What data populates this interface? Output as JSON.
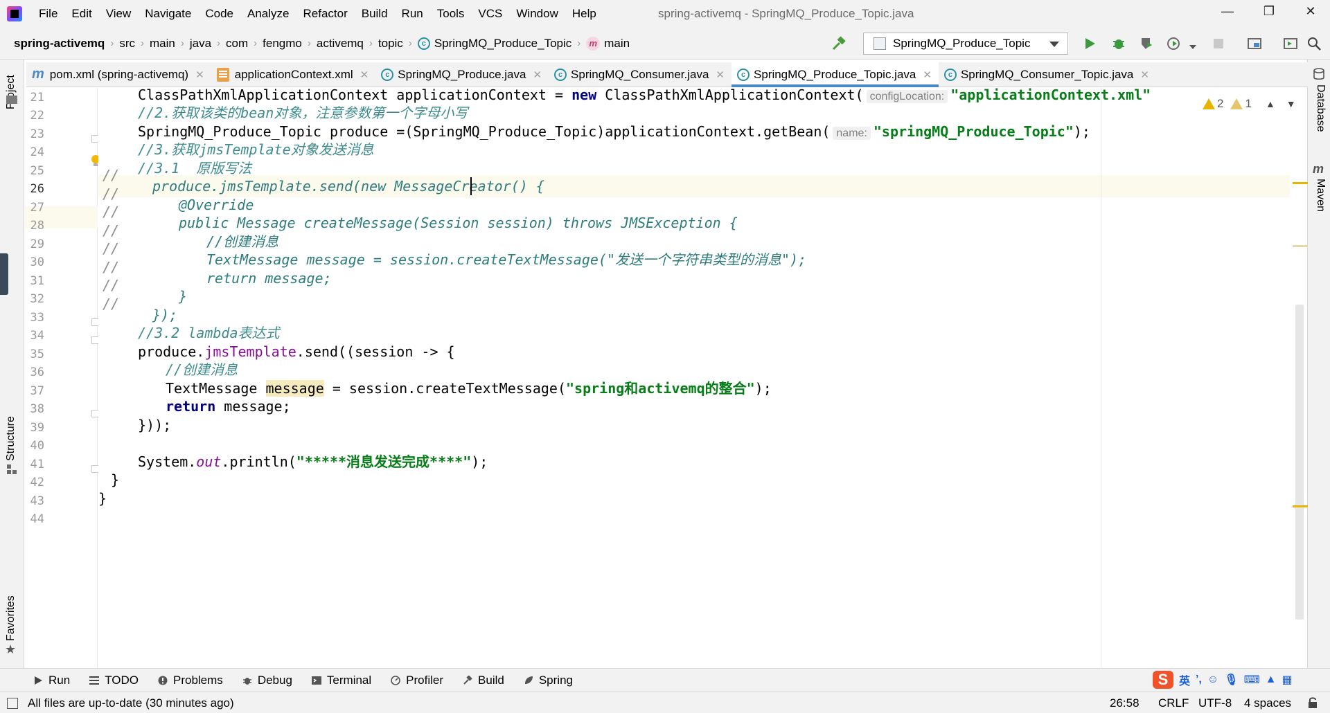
{
  "menu": {
    "items": [
      "File",
      "Edit",
      "View",
      "Navigate",
      "Code",
      "Analyze",
      "Refactor",
      "Build",
      "Run",
      "Tools",
      "VCS",
      "Window",
      "Help"
    ],
    "window_title": "spring-activemq - SpringMQ_Produce_Topic.java"
  },
  "nav": {
    "project": "spring-activemq",
    "crumbs": [
      "src",
      "main",
      "java",
      "com",
      "fengmo",
      "activemq",
      "topic",
      "SpringMQ_Produce_Topic",
      "main"
    ],
    "run_config": "SpringMQ_Produce_Topic"
  },
  "tabs": [
    {
      "label": "pom.xml (spring-activemq)",
      "icon": "maven-icon",
      "active": false
    },
    {
      "label": "applicationContext.xml",
      "icon": "xml-icon",
      "active": false
    },
    {
      "label": "SpringMQ_Produce.java",
      "icon": "class-icon",
      "active": false
    },
    {
      "label": "SpringMQ_Consumer.java",
      "icon": "class-icon",
      "active": false
    },
    {
      "label": "SpringMQ_Produce_Topic.java",
      "icon": "class-icon",
      "active": true
    },
    {
      "label": "SpringMQ_Consumer_Topic.java",
      "icon": "class-icon",
      "active": false
    }
  ],
  "side": {
    "left": [
      "Project",
      "Structure",
      "Favorites"
    ],
    "right": [
      "Database",
      "Maven"
    ]
  },
  "editor": {
    "line_numbers": [
      "21",
      "22",
      "23",
      "24",
      "25",
      "26",
      "27",
      "28",
      "29",
      "30",
      "31",
      "32",
      "33",
      "34",
      "35",
      "36",
      "37",
      "38",
      "39",
      "40",
      "41",
      "42",
      "43",
      "44"
    ],
    "current_line": "26",
    "hints": {
      "config_location": "configLocation:",
      "name": "name:"
    },
    "strings": {
      "app_ctx": "\"applicationContext.xml\"",
      "bean_name": "\"springMQ_Produce_Topic\"",
      "msg1": "\"发送一个字符串类型的消息\"",
      "msg2": "\"spring和activemq的整合\"",
      "done": "\"*****消息发送完成****\""
    },
    "comments": {
      "c22": "//2.获取该类的bean对象，注意参数第一个字母小写",
      "c24": "//3.获取jmsTemplate对象发送消息",
      "c25": "//3.1  原版写法",
      "c29": "//创建消息",
      "c34": "//3.2 lambda表达式",
      "c36": "//创建消息"
    },
    "inspections": {
      "warnings": "2",
      "weak_warnings": "1"
    }
  },
  "bottom_tools": [
    "Run",
    "TODO",
    "Problems",
    "Debug",
    "Terminal",
    "Profiler",
    "Build",
    "Spring"
  ],
  "status": {
    "message": "All files are up-to-date (30 minutes ago)",
    "position": "26:58",
    "line_sep": "CRLF",
    "encoding": "UTF-8",
    "indent": "4 spaces"
  },
  "ime": {
    "lang": "英"
  }
}
